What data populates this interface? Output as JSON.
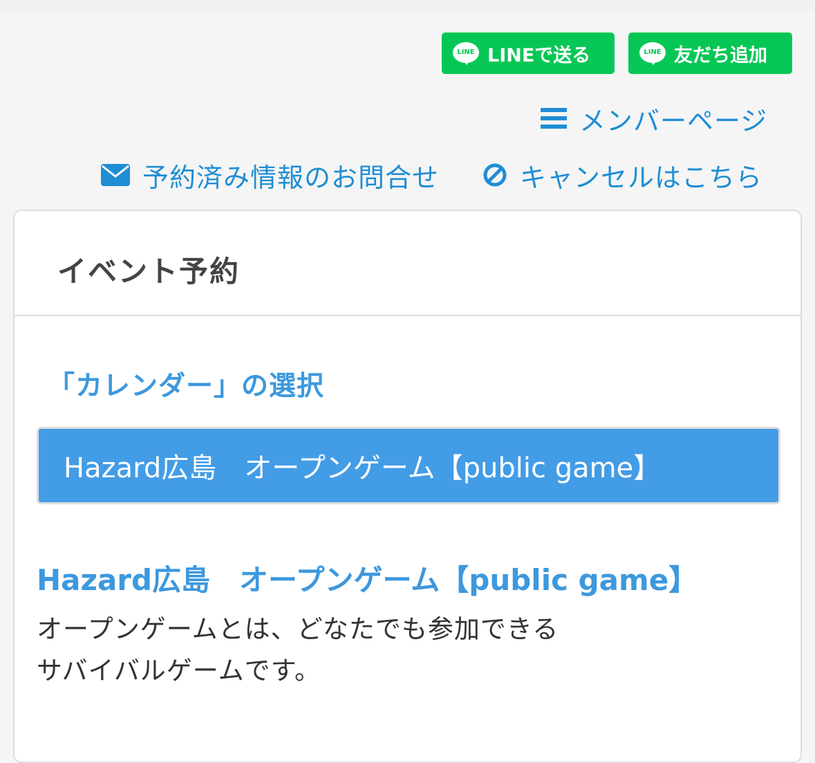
{
  "line_buttons": {
    "send_label": "LINEで送る",
    "add_friend_label": "友だち追加",
    "icon_text": "LINE"
  },
  "links": {
    "member_page": "メンバーページ",
    "reservation_inquiry": "予約済み情報のお問合せ",
    "cancel": "キャンセルはこちら"
  },
  "card": {
    "title": "イベント予約",
    "calendar_heading": "「カレンダー」の選択",
    "calendar_selected": "Hazard広島　オープンゲーム【public game】",
    "event_title": "Hazard広島　オープンゲーム【public game】",
    "event_description_line1": "オープンゲームとは、どなたでも参加できる",
    "event_description_line2": "サバイバルゲームです。"
  },
  "colors": {
    "line_green": "#06c755",
    "link_blue": "#1f8ed4",
    "heading_blue": "#3d98dd",
    "select_blue": "#439ce6",
    "title_gray": "#444444"
  },
  "icons": [
    "line-icon",
    "menu-icon",
    "envelope-icon",
    "ban-icon"
  ]
}
